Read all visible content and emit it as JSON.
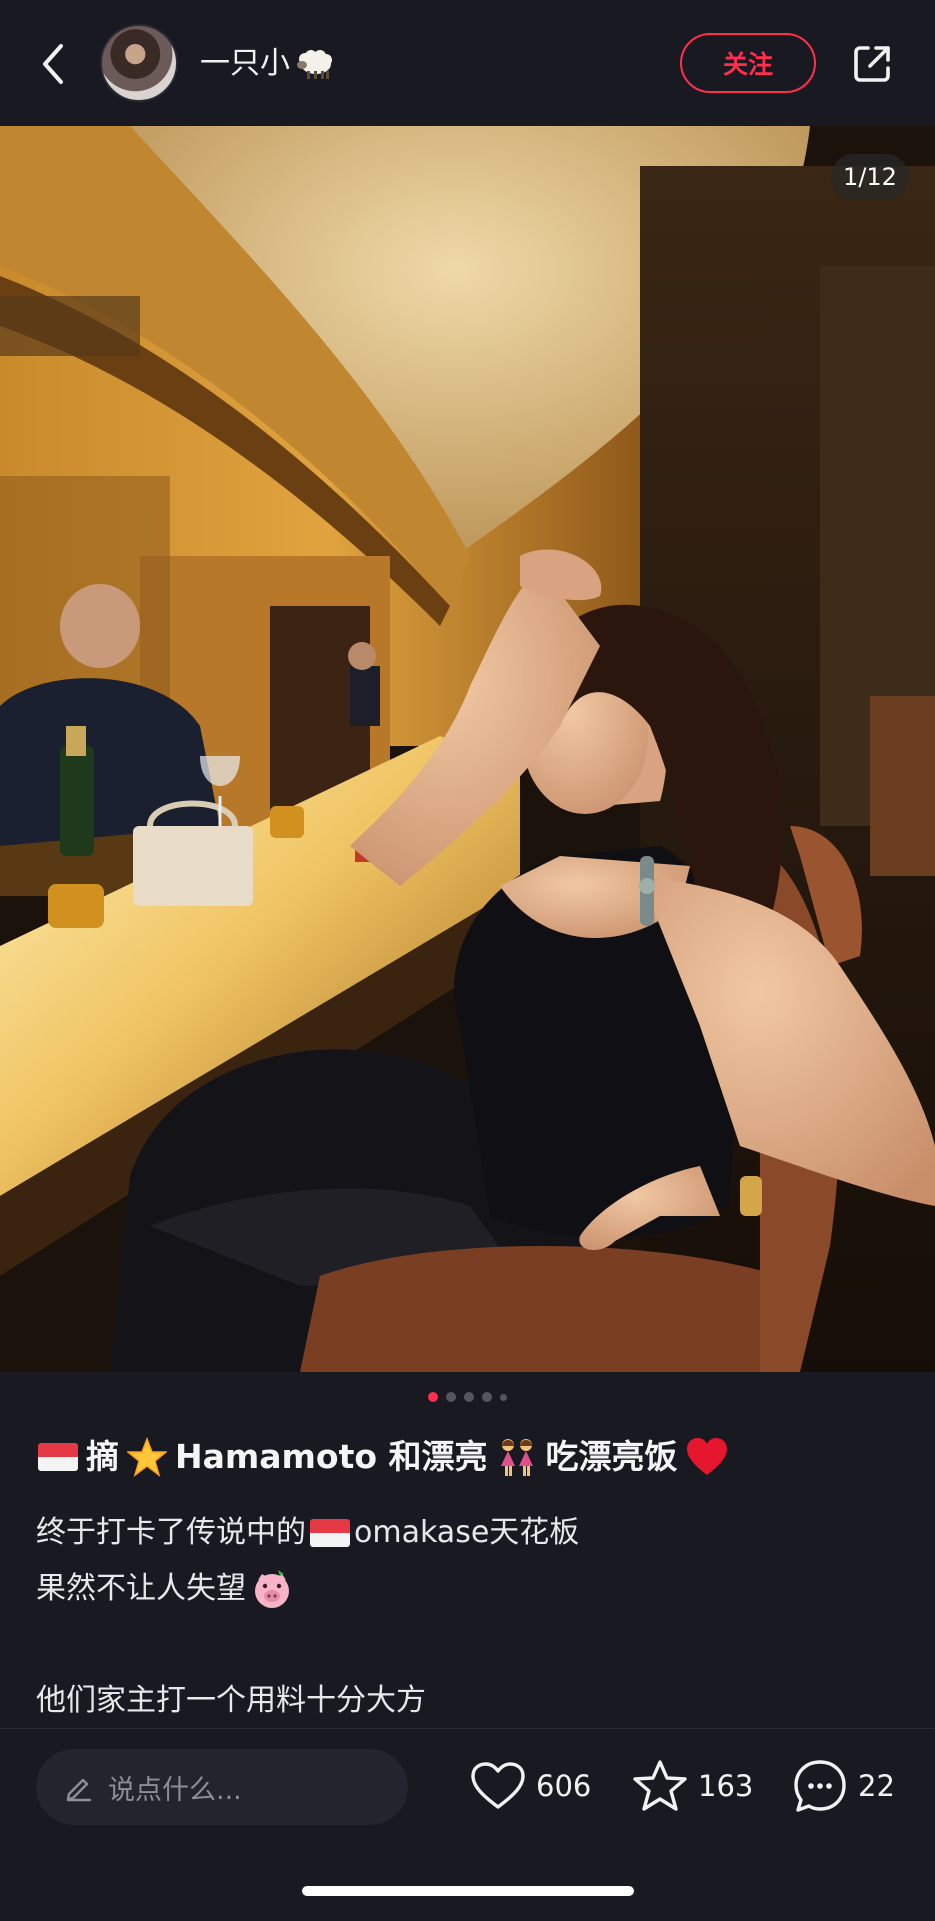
{
  "header": {
    "back_icon": "chevron-left-icon",
    "username": "一只小",
    "username_emoji": "sheep-icon",
    "follow_label": "关注",
    "share_icon": "share-icon"
  },
  "photo": {
    "counter": "1/12",
    "carousel_total_dots": 5,
    "active_index": 0
  },
  "post": {
    "title_prefix": "摘",
    "title_main": "Hamamoto 和漂亮",
    "title_suffix": "吃漂亮饭",
    "line1_a": "终于打卡了传说中的",
    "line1_b": "omakase天花板",
    "line2": "果然不让人失望",
    "line3": "他们家主打一个用料十分大方"
  },
  "bottom": {
    "comment_placeholder": "说点什么...",
    "likes": "606",
    "favorites": "163",
    "comments": "22"
  },
  "colors": {
    "accent": "#ff2e4d",
    "background": "#191922",
    "input_bg": "#24242e"
  }
}
